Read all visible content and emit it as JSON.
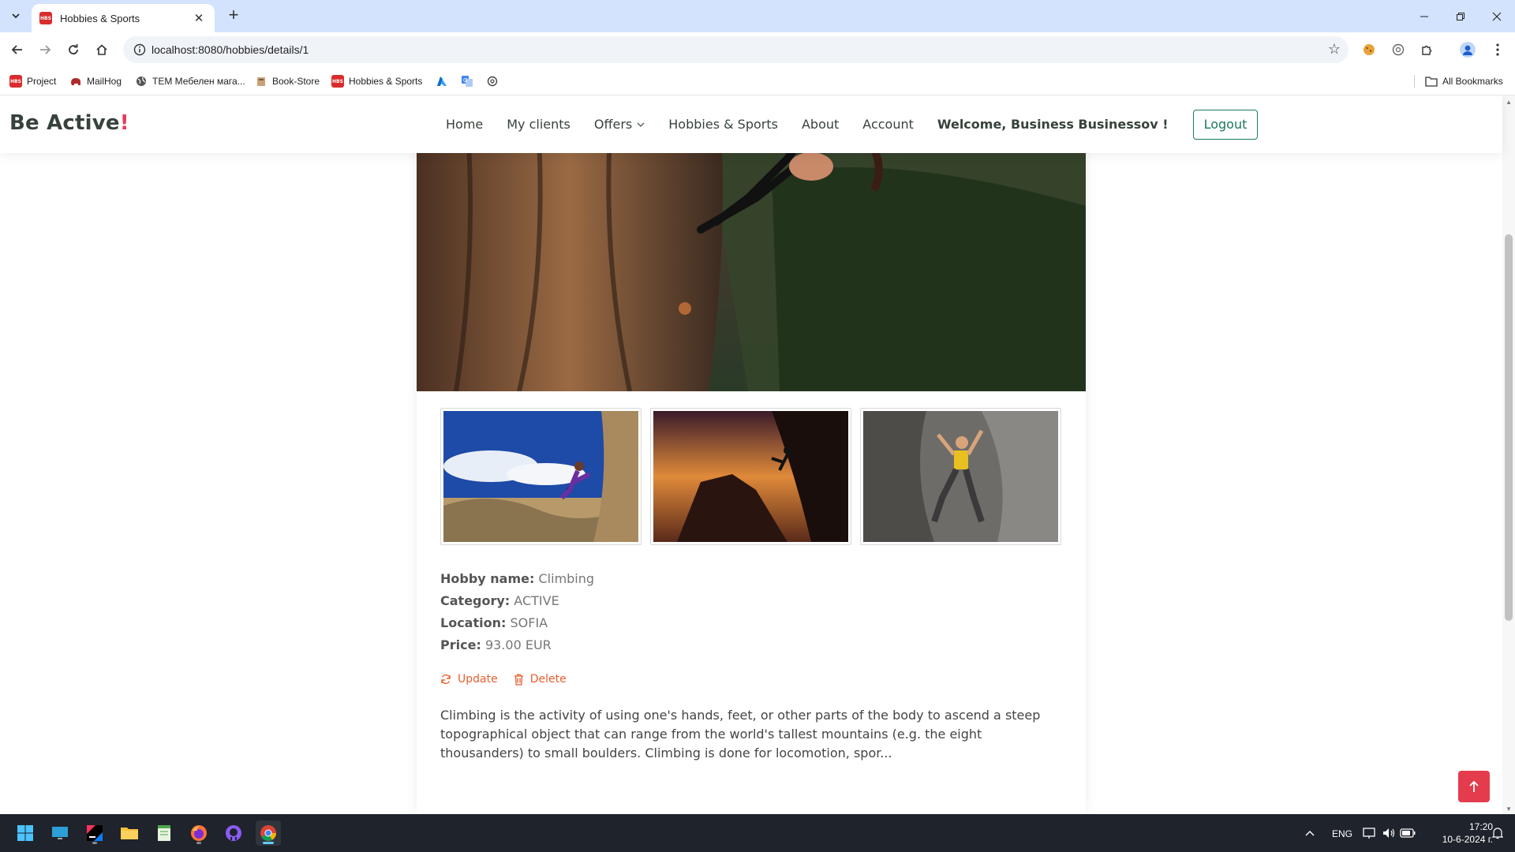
{
  "browser": {
    "tab_title": "Hobbies & Sports",
    "url": "localhost:8080/hobbies/details/1",
    "favicon_text": "HBS",
    "bookmarks": [
      {
        "label": "Project"
      },
      {
        "label": "MailHog"
      },
      {
        "label": "TEM Мебелен мага..."
      },
      {
        "label": "Book-Store"
      },
      {
        "label": "Hobbies & Sports"
      }
    ],
    "all_bookmarks_label": "All Bookmarks"
  },
  "site": {
    "logo_text": "Be Active",
    "logo_mark": "!",
    "nav": {
      "home": "Home",
      "my_clients": "My clients",
      "offers": "Offers",
      "hobbies": "Hobbies & Sports",
      "about": "About",
      "account": "Account",
      "welcome": "Welcome, Business Businessov !",
      "logout": "Logout"
    }
  },
  "hobby": {
    "name_label": "Hobby name:",
    "name": "Climbing",
    "category_label": "Category:",
    "category": "ACTIVE",
    "location_label": "Location:",
    "location": "SOFIA",
    "price_label": "Price:",
    "price": "93.00 EUR",
    "update_label": "Update",
    "delete_label": "Delete",
    "description": "Climbing is the activity of using one's hands, feet, or other parts of the body to ascend a steep topographical object that can range from the world's tallest mountains (e.g. the eight thousanders) to small boulders. Climbing is done for locomotion, spor..."
  },
  "taskbar": {
    "language": "ENG",
    "time": "17:20",
    "date": "10-6-2024 г."
  },
  "colors": {
    "accent_red": "#e43c4c",
    "logout_green": "#1b7a5a",
    "action_orange": "#e95e2f",
    "chrome_tab_bg": "#d3e3fd"
  }
}
